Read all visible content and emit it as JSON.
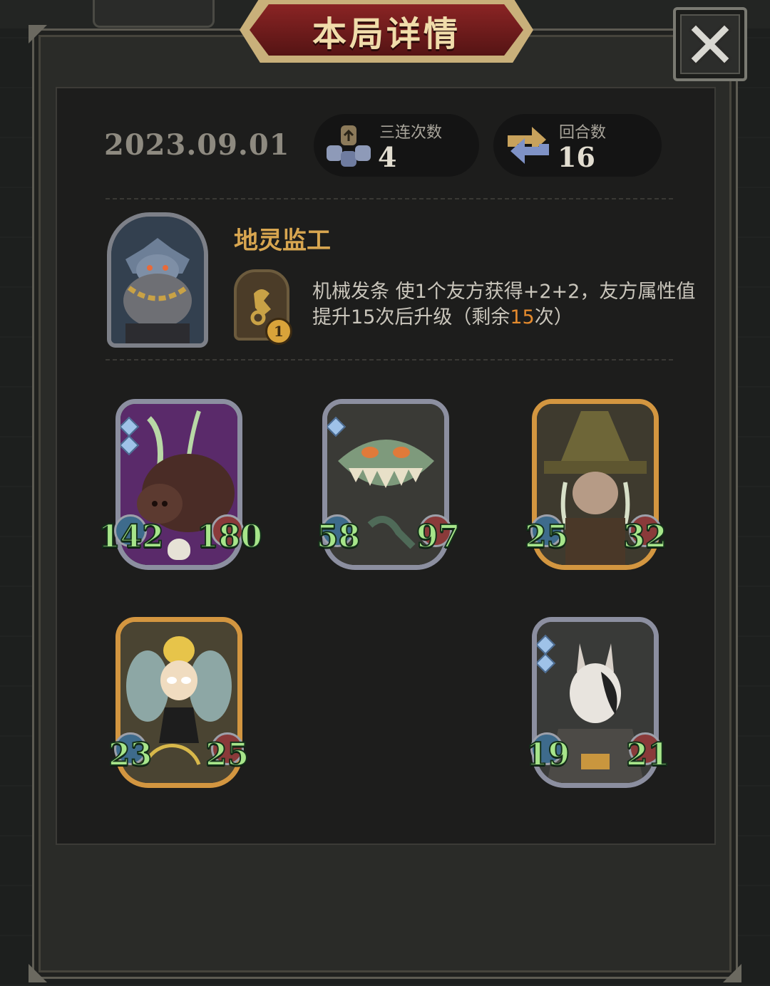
{
  "header": {
    "title": "本局详情"
  },
  "summary": {
    "date": "2023.09.01",
    "triple": {
      "label": "三连次数",
      "value": "4"
    },
    "rounds": {
      "label": "回合数",
      "value": "16"
    }
  },
  "hero": {
    "name": "地灵监工",
    "skill_level": "1",
    "skill_desc_before": "机械发条 使1个友方获得+2+2，友方属性值提升15次后升级（剩余",
    "skill_remaining": "15",
    "skill_desc_after": "次）"
  },
  "units": [
    {
      "id": "boar",
      "attack": "142",
      "health": "180"
    },
    {
      "id": "plant",
      "attack": "58",
      "health": "97"
    },
    {
      "id": "witch",
      "attack": "25",
      "health": "32"
    },
    {
      "id": "fairy",
      "attack": "23",
      "health": "25"
    },
    {
      "id": "rabbit",
      "attack": "19",
      "health": "21"
    }
  ],
  "colors": {
    "accent": "#d8a650",
    "stat_green": "#a7e58a",
    "banner_red": "#6e1a1a"
  }
}
